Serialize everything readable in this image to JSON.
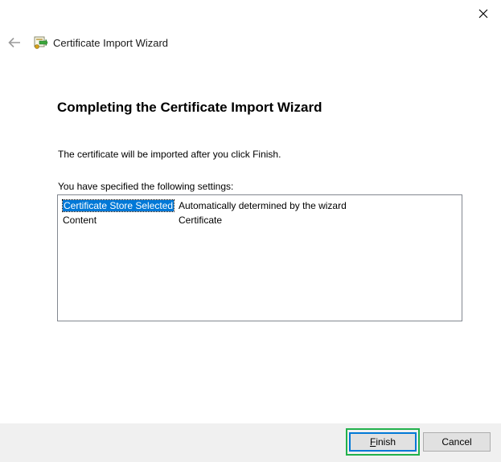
{
  "window": {
    "title": "Certificate Import Wizard"
  },
  "page": {
    "heading": "Completing the Certificate Import Wizard",
    "description": "The certificate will be imported after you click Finish.",
    "settings_label": "You have specified the following settings:"
  },
  "settings": [
    {
      "key": "Certificate Store Selected",
      "value": "Automatically determined by the wizard",
      "selected": true
    },
    {
      "key": "Content",
      "value": "Certificate",
      "selected": false
    }
  ],
  "buttons": {
    "finish_mnemonic": "F",
    "finish_rest": "inish",
    "cancel": "Cancel"
  },
  "colors": {
    "selection": "#0078d7",
    "highlight": "#22b14c",
    "footer_bg": "#f0f0f0"
  },
  "icons": {
    "back": "back-arrow-icon",
    "wizard": "certificate-wizard-icon",
    "close": "close-icon"
  }
}
